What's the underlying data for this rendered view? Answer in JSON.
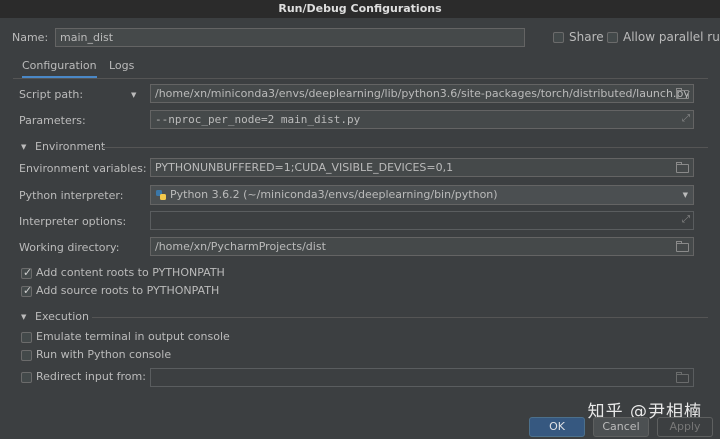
{
  "window": {
    "title": "Run/Debug Configurations"
  },
  "name_row": {
    "label": "Name:",
    "value": "main_dist",
    "share_label": "Share",
    "parallel_label": "Allow parallel run"
  },
  "tabs": [
    {
      "label": "Configuration"
    },
    {
      "label": "Logs"
    }
  ],
  "form": {
    "script_path_label": "Script path:",
    "script_path_value": "/home/xn/miniconda3/envs/deeplearning/lib/python3.6/site-packages/torch/distributed/launch.py",
    "parameters_label": "Parameters:",
    "parameters_value": "--nproc_per_node=2 main_dist.py",
    "environment_section": "Environment",
    "env_vars_label": "Environment variables:",
    "env_vars_value": "PYTHONUNBUFFERED=1;CUDA_VISIBLE_DEVICES=0,1",
    "interpreter_label": "Python interpreter:",
    "interpreter_value": "Python 3.6.2 (~/miniconda3/envs/deeplearning/bin/python)",
    "interp_options_label": "Interpreter options:",
    "interp_options_value": "",
    "workdir_label": "Working directory:",
    "workdir_value": "/home/xn/PycharmProjects/dist",
    "add_content_roots": "Add content roots to PYTHONPATH",
    "add_source_roots": "Add source roots to PYTHONPATH",
    "execution_section": "Execution",
    "emulate_terminal": "Emulate terminal in output console",
    "run_python_console": "Run with Python console",
    "redirect_input": "Redirect input from:",
    "redirect_value": ""
  },
  "checks": {
    "share": false,
    "parallel": false,
    "content_roots": true,
    "source_roots": true,
    "emulate": false,
    "python_console": false,
    "redirect": false
  },
  "buttons": {
    "ok": "OK",
    "cancel": "Cancel",
    "apply": "Apply"
  },
  "watermark": "知乎 @尹相楠",
  "colors": {
    "accent": "#4a88c7",
    "ok_button": "#365880",
    "background": "#3c3f41"
  }
}
